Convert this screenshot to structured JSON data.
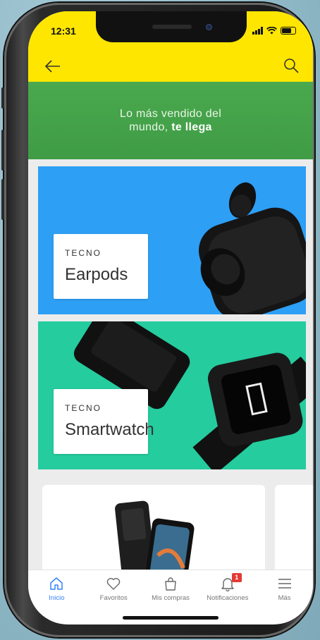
{
  "status": {
    "time": "12:31"
  },
  "hero": {
    "line1": "Lo más vendido del",
    "line2_prefix": "mundo, ",
    "line2_bold": "te llega"
  },
  "banners": [
    {
      "category": "TECNO",
      "title": "Earpods",
      "color": "#2d9ff5"
    },
    {
      "category": "TECNO",
      "title": "Smartwatch",
      "color": "#25cc9e"
    }
  ],
  "tabs": [
    {
      "label": "Inicio",
      "icon": "home-icon",
      "active": true
    },
    {
      "label": "Favoritos",
      "icon": "heart-icon",
      "active": false
    },
    {
      "label": "Mis compras",
      "icon": "bag-icon",
      "active": false
    },
    {
      "label": "Notificaciones",
      "icon": "bell-icon",
      "active": false,
      "badge": "1"
    },
    {
      "label": "Más",
      "icon": "menu-icon",
      "active": false
    }
  ],
  "colors": {
    "appbar": "#ffe600",
    "hero": "#3f9c45",
    "active_tab": "#3483fa",
    "badge": "#e53935"
  }
}
